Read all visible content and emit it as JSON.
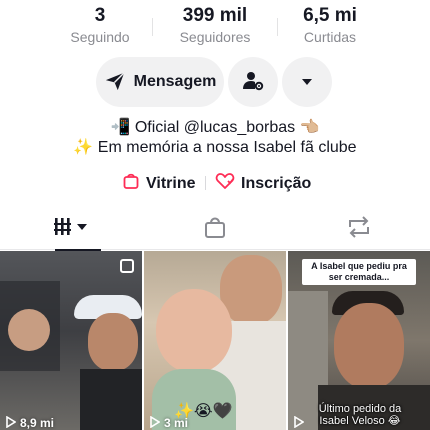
{
  "stats": [
    {
      "value": "3",
      "label": "Seguindo"
    },
    {
      "value": "399 mil",
      "label": "Seguidores"
    },
    {
      "value": "6,5 mi",
      "label": "Curtidas"
    }
  ],
  "actions": {
    "message_label": "Mensagem",
    "message_icon": "send-icon",
    "user_icon": "user-settings-icon",
    "more_icon": "chevron-down-icon"
  },
  "bio": {
    "line1": "📲 Oficial @lucas_borbas 👈🏼",
    "line2": "✨ Em memória a nossa Isabel fã clube"
  },
  "links": {
    "vitrine_label": "Vitrine",
    "inscricao_label": "Inscrição",
    "accent_color": "#fe2c55"
  },
  "tabs": [
    {
      "icon": "grid-icon",
      "selected": true
    },
    {
      "icon": "shopping-bag-icon",
      "selected": false
    },
    {
      "icon": "repost-icon",
      "selected": false
    }
  ],
  "videos": [
    {
      "views": "8,9 mi",
      "pinned": true
    },
    {
      "views": "3 mi",
      "overlay_text": "✨😭🖤"
    },
    {
      "views": "",
      "top_caption": "A Isabel que pediu pra ser cremada...",
      "bottom_caption": "Último pedido da Isabel Veloso 😂"
    }
  ]
}
